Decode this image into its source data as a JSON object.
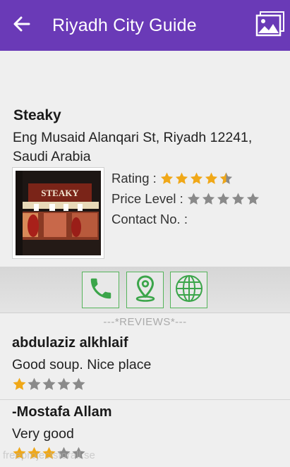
{
  "appbar": {
    "title": "Riyadh City Guide",
    "back_icon": "arrow-left",
    "gallery_icon": "gallery",
    "color": "#6a3ab7"
  },
  "place": {
    "name": "Steaky",
    "address": "Eng Musaid Alanqari St, Riyadh 12241, Saudi Arabia",
    "photo_sign": "STEAKY",
    "rating_label": "Rating :",
    "rating": 4.5,
    "price_label": "Price Level :",
    "price_level": 0,
    "contact_label": "Contact No. :",
    "contact_value": ""
  },
  "actions": {
    "call_icon": "phone",
    "map_icon": "map-pin",
    "web_icon": "globe",
    "accent": "#3ba54a"
  },
  "reviews_header": "---*REVIEWS*---",
  "reviews": [
    {
      "author": "abdulaziz alkhlaif",
      "text": "Good soup. Nice place",
      "rating": 1
    },
    {
      "author": "-Mostafa Allam",
      "text": "Very good",
      "rating": 3
    }
  ],
  "colors": {
    "star_filled": "#f0a818",
    "star_empty": "#8a8a8a"
  },
  "watermark": "freeprojectsforall.se"
}
